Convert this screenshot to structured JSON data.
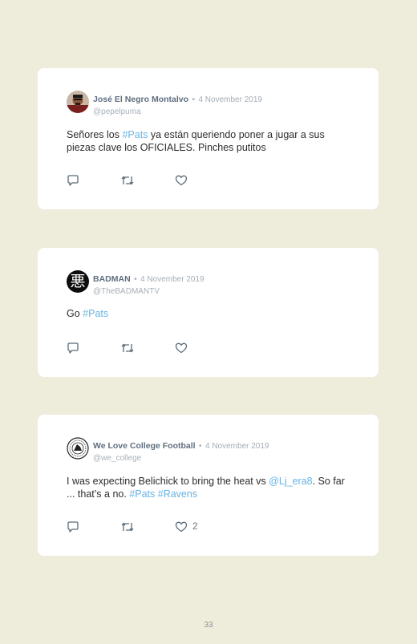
{
  "page_number": "33",
  "tweets": [
    {
      "name": "José El Negro Montalvo",
      "sep": "•",
      "date": "4 November 2019",
      "handle": "@pepelpuma",
      "text_a": "Señores los ",
      "tag_1": "#Pats",
      "text_b": " ya están queriendo poner a jugar a sus piezas clave los OFICIALES. Pinches putitos",
      "likes": ""
    },
    {
      "name": "BADMAN",
      "sep": "•",
      "date": "4 November 2019",
      "handle": "@TheBADMANTV",
      "text_a": "Go ",
      "tag_1": "#Pats",
      "avatar_glyph": "悪",
      "likes": ""
    },
    {
      "name": "We Love College Football",
      "sep": "•",
      "date": "4 November 2019",
      "handle": "@we_college",
      "text_a": "I was expecting Belichick to bring the heat vs ",
      "mention": "@Lj_era8",
      "text_b": ". So far ... that’s a no. ",
      "tag_1": "#Pats",
      "tag_2": "#Ravens",
      "likes": "2"
    }
  ],
  "icons": {
    "reply": "reply-icon",
    "retweet": "retweet-icon",
    "like": "heart-icon"
  },
  "colors": {
    "background": "#eeecdb",
    "card": "#ffffff",
    "hashtag": "#67b3e6",
    "name": "#5f6f7f"
  }
}
